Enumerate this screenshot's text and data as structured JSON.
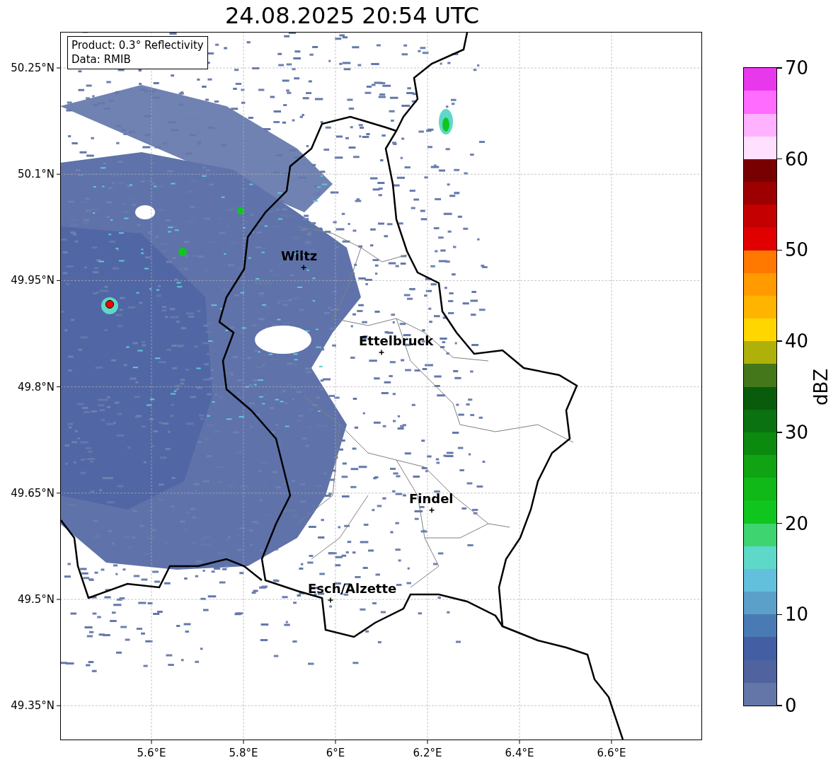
{
  "title": "24.08.2025 20:54 UTC",
  "info_box": {
    "lines": [
      "Product: 0.3° Reflectivity",
      "Data: RMIB"
    ]
  },
  "map": {
    "lat_ticks": [
      "50.25°N",
      "50.1°N",
      "49.95°N",
      "49.8°N",
      "49.65°N",
      "49.5°N",
      "49.35°N"
    ],
    "lon_ticks": [
      "5.6°E",
      "5.8°E",
      "6°E",
      "6.2°E",
      "6.4°E",
      "6.6°E"
    ],
    "cities": [
      {
        "name": "Wiltz"
      },
      {
        "name": "Ettelbruck"
      },
      {
        "name": "Findel"
      },
      {
        "name": "Esch/Alzette"
      }
    ]
  },
  "colorbar": {
    "label": "dBZ",
    "ticks": [
      "70",
      "60",
      "50",
      "40",
      "30",
      "20",
      "10",
      "0"
    ],
    "bands": [
      {
        "color": "#6475a8"
      },
      {
        "color": "#50639f"
      },
      {
        "color": "#435ea3"
      },
      {
        "color": "#4a7ab4"
      },
      {
        "color": "#5aa0c8"
      },
      {
        "color": "#62c0dc"
      },
      {
        "color": "#5ed8c8"
      },
      {
        "color": "#3ed470"
      },
      {
        "color": "#10c61e"
      },
      {
        "color": "#10b818"
      },
      {
        "color": "#10a414"
      },
      {
        "color": "#0c8a10"
      },
      {
        "color": "#0a7210"
      },
      {
        "color": "#085c0c"
      },
      {
        "color": "#44761a"
      },
      {
        "color": "#b0b00a"
      },
      {
        "color": "#ffd600"
      },
      {
        "color": "#ffb400"
      },
      {
        "color": "#ff9a00"
      },
      {
        "color": "#ff7800"
      },
      {
        "color": "#e00000"
      },
      {
        "color": "#c40000"
      },
      {
        "color": "#9c0000"
      },
      {
        "color": "#780000"
      },
      {
        "color": "#ffe0ff"
      },
      {
        "color": "#ffb2ff"
      },
      {
        "color": "#ff6cff"
      },
      {
        "color": "#e838ec"
      }
    ]
  }
}
